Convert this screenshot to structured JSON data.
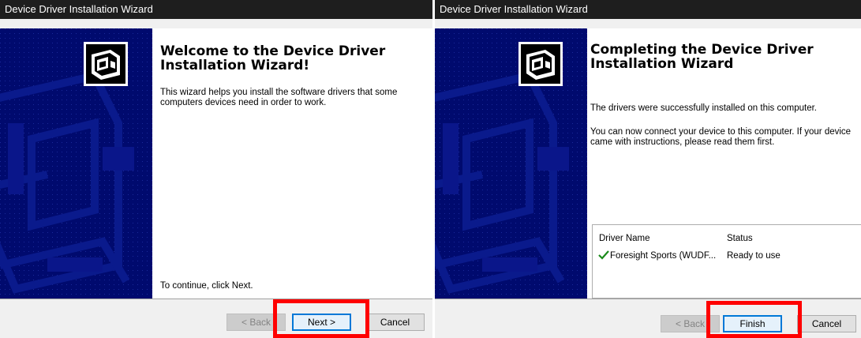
{
  "colors": {
    "title_bar": "#1e1e1e",
    "sidebar": "#000a6e",
    "highlight": "#ff0000",
    "default_button_border": "#0078d7",
    "check": "#1a8a1a"
  },
  "welcome_window": {
    "title": "Device Driver Installation Wizard",
    "heading": "Welcome to the Device Driver\nInstallation Wizard!",
    "description": "This wizard helps you install the software drivers that some computers devices need in order to work.",
    "continue_text": "To continue, click Next.",
    "buttons": {
      "back": "< Back",
      "next": "Next >",
      "cancel": "Cancel"
    },
    "logo_icon": "hardware-install-icon"
  },
  "completing_window": {
    "title": "Device Driver Installation Wizard",
    "heading": "Completing the Device Driver\nInstallation Wizard",
    "success_text": "The drivers were successfully installed on this computer.",
    "instructions_text": "You can now connect your device to this computer. If your device came with instructions, please read them first.",
    "driver_table": {
      "columns": [
        "Driver Name",
        "Status"
      ],
      "rows": [
        {
          "name": "Foresight Sports (WUDF...",
          "status": "Ready to use",
          "icon": "check-icon"
        }
      ]
    },
    "buttons": {
      "back": "< Back",
      "finish": "Finish",
      "cancel": "Cancel"
    },
    "logo_icon": "hardware-install-icon"
  }
}
